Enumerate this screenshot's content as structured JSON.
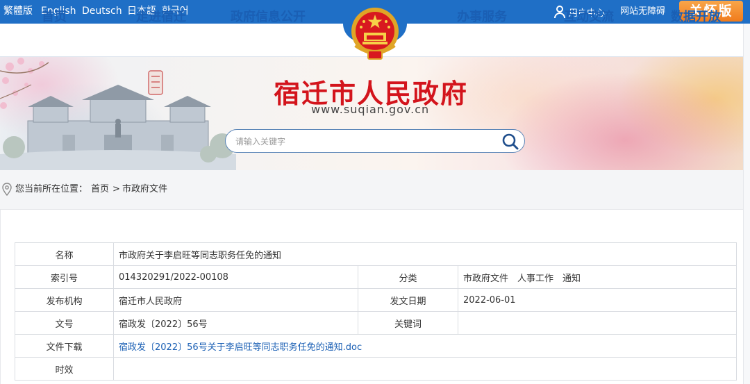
{
  "top_bar": {
    "languages": [
      "繁體版",
      "English",
      "Deutsch",
      "日本語",
      "한국어"
    ],
    "user_center": "用户中心",
    "accessibility": "网站无障碍",
    "care_mode": "关怀版"
  },
  "nav": {
    "items": [
      "首页",
      "走进宿迁",
      "政府信息公开",
      "办事服务",
      "互动交流",
      "数据开放"
    ]
  },
  "banner": {
    "title": "宿迁市人民政府",
    "url": "www.suqian.gov.cn",
    "search_placeholder": "请输入关键字"
  },
  "breadcrumb": {
    "prefix": "您当前所在位置：",
    "items": [
      "首页",
      "市政府文件"
    ],
    "separator": ">"
  },
  "document": {
    "labels": {
      "name": "名称",
      "index_no": "索引号",
      "category": "分类",
      "publisher": "发布机构",
      "date": "发文日期",
      "doc_no": "文号",
      "keywords": "关键词",
      "download": "文件下载",
      "validity": "时效"
    },
    "name": "市政府关于李启旺等同志职务任免的通知",
    "index_no": "014320291/2022-00108",
    "category": "市政府文件　人事工作　通知",
    "publisher": "宿迁市人民政府",
    "date": "2022-06-01",
    "doc_no": "宿政发〔2022〕56号",
    "keywords": "",
    "download": "宿政发〔2022〕56号关于李启旺等同志职务任免的通知.doc",
    "validity": ""
  },
  "colors": {
    "top_bar": "#1f6fc6",
    "nav_text": "#1a5fb4",
    "site_title": "#d3141c",
    "care_button": "#f07b1c",
    "link": "#1a5fb4"
  },
  "icons": [
    "user-icon",
    "search-icon",
    "location-pin-icon",
    "national-emblem"
  ]
}
